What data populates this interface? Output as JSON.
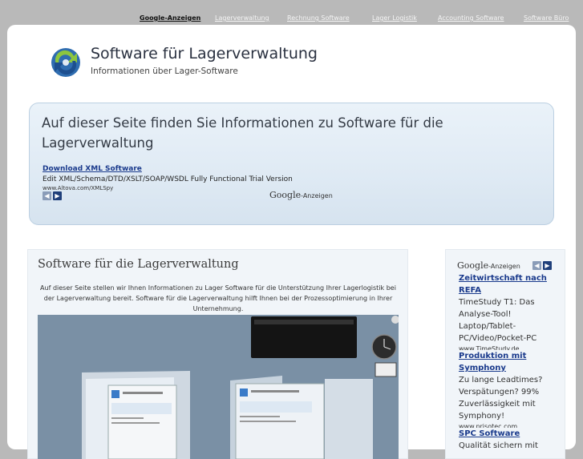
{
  "topnav": [
    {
      "label": "Google-Anzeigen",
      "strong": true
    },
    {
      "label": "Lagerverwaltung"
    },
    {
      "label": "Rechnung Software"
    },
    {
      "label": "Lager Logistik"
    },
    {
      "label": "Accounting Software"
    },
    {
      "label": "Software Büro"
    }
  ],
  "header": {
    "title": "Software für Lagerverwaltung",
    "subtitle": "Informationen über Lager-Software"
  },
  "hero": {
    "heading": "Auf dieser Seite finden Sie Informationen zu Software für die Lagerverwaltung",
    "ad": {
      "title": "Download XML Software",
      "desc": "Edit XML/Schema/DTD/XSLT/SOAP/WSDL Fully Functional Trial Version",
      "url": "www.Altova.com/XMLSpy"
    },
    "google_label": "Google",
    "anzeigen_label": "-Anzeigen"
  },
  "main": {
    "heading": "Software für die Lagerverwaltung",
    "paragraph": "Auf dieser Seite stellen wir Ihnen Informationen zu Lager Software für die Unterstützung Ihrer Lagerlogistik bei der Lagerverwaltung bereit. Software für die Lagerverwaltung hilft Ihnen bei der Prozessoptimierung in Ihrer Unternehmung."
  },
  "sidebar": {
    "google_label": "Google",
    "anzeigen_label": "-Anzeigen",
    "ads": [
      {
        "title": "Zeitwirtschaft nach REFA",
        "desc": "TimeStudy T1: Das Analyse-Tool! Laptop/Tablet-PC/Video/Pocket-PC",
        "url": "www.TimeStudy.de"
      },
      {
        "title": "Produktion mit Symphony",
        "desc": "Zu lange Leadtimes? Verspätungen? 99% Zuverlässigkeit mit Symphony!",
        "url": "www.prisotec.com"
      },
      {
        "title": "SPC Software",
        "desc": "Qualität sichern mit",
        "url": ""
      }
    ]
  },
  "colors": {
    "accent": "#1a3a8c",
    "hero_bg": "#dfeaf4",
    "page_bg": "#b9b9b9"
  }
}
